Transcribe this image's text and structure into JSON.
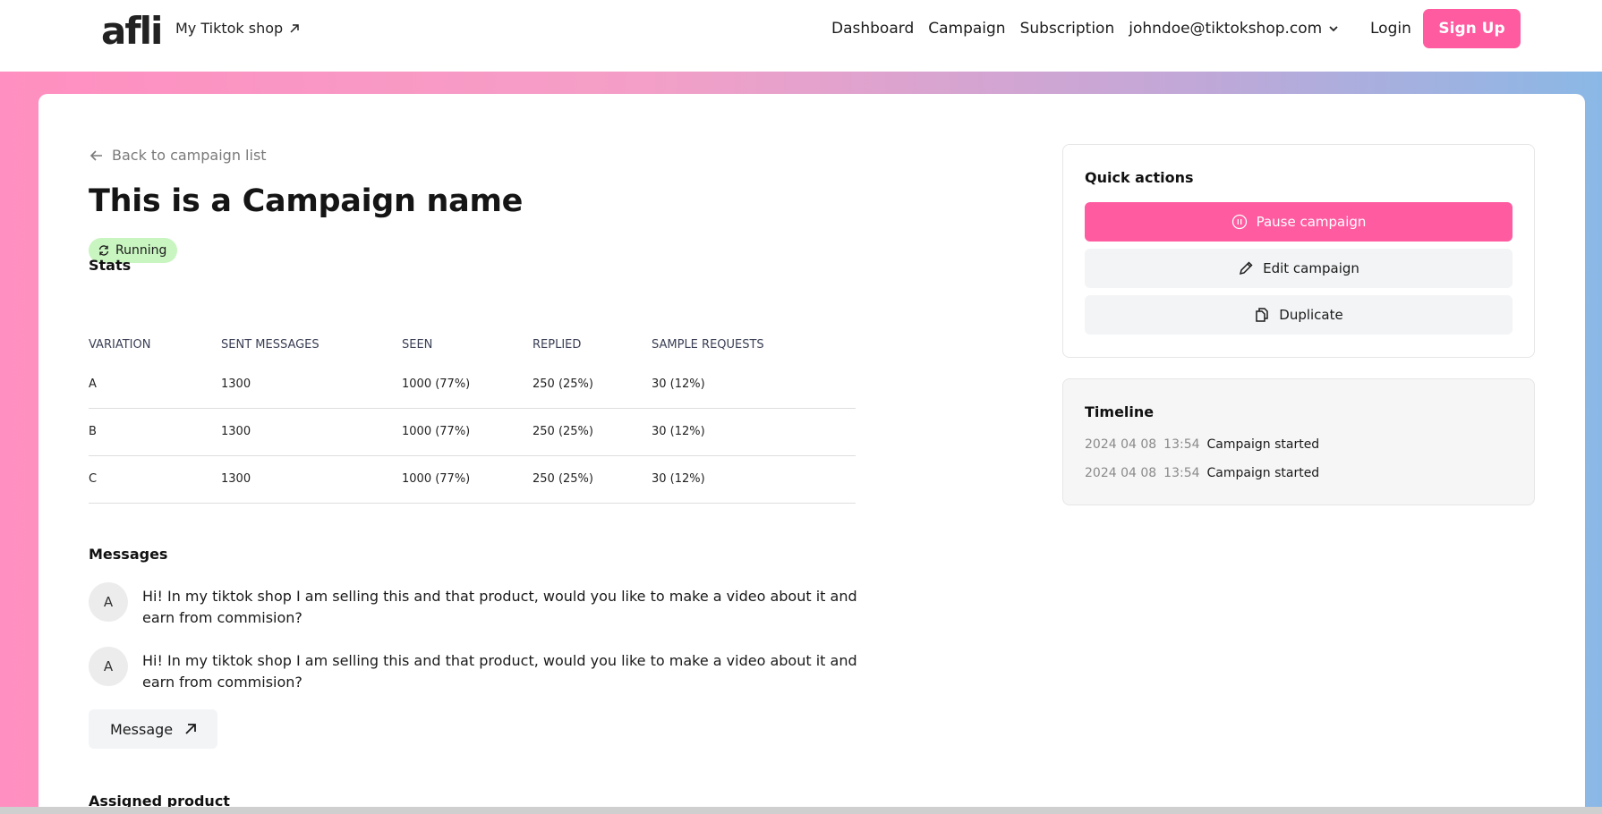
{
  "header": {
    "logo": "afli",
    "shop_link": "My Tiktok shop",
    "nav": [
      "Dashboard",
      "Campaign",
      "Subscription"
    ],
    "user_email": "johndoe@tiktokshop.com",
    "login": "Login",
    "signup": "Sign Up"
  },
  "page": {
    "back_link": "Back to campaign list",
    "title": "This is a Campaign name",
    "status": "Running"
  },
  "stats": {
    "section_title": "Stats",
    "columns": [
      "VARIATION",
      "SENT MESSAGES",
      "SEEN",
      "REPLIED",
      "SAMPLE REQUESTS"
    ],
    "rows": [
      [
        "A",
        "1300",
        "1000 (77%)",
        "250 (25%)",
        "30 (12%)"
      ],
      [
        "B",
        "1300",
        "1000 (77%)",
        "250 (25%)",
        "30 (12%)"
      ],
      [
        "C",
        "1300",
        "1000 (77%)",
        "250 (25%)",
        "30 (12%)"
      ]
    ]
  },
  "messages": {
    "section_title": "Messages",
    "items": [
      {
        "avatar": "A",
        "text": "Hi! In my tiktok shop I am selling this and that product, would you like to make a video about it and earn from commision?"
      },
      {
        "avatar": "A",
        "text": "Hi! In my tiktok shop I am selling this and that product, would you like to make a video about it and earn from commision?"
      }
    ],
    "button": "Message"
  },
  "assigned_product": {
    "section_title": "Assigned product"
  },
  "quick_actions": {
    "title": "Quick actions",
    "pause": "Pause campaign",
    "edit": "Edit campaign",
    "duplicate": "Duplicate"
  },
  "timeline": {
    "title": "Timeline",
    "events": [
      {
        "date": "2024 04 08",
        "time": "13:54",
        "event": "Campaign started"
      },
      {
        "date": "2024 04 08",
        "time": "13:54",
        "event": "Campaign started"
      }
    ]
  },
  "colors": {
    "brand_pink": "#ff5ba0",
    "running_badge": "#c8f5c0",
    "gradient_start": "#ff8fc0",
    "gradient_end": "#8ab8e6"
  }
}
